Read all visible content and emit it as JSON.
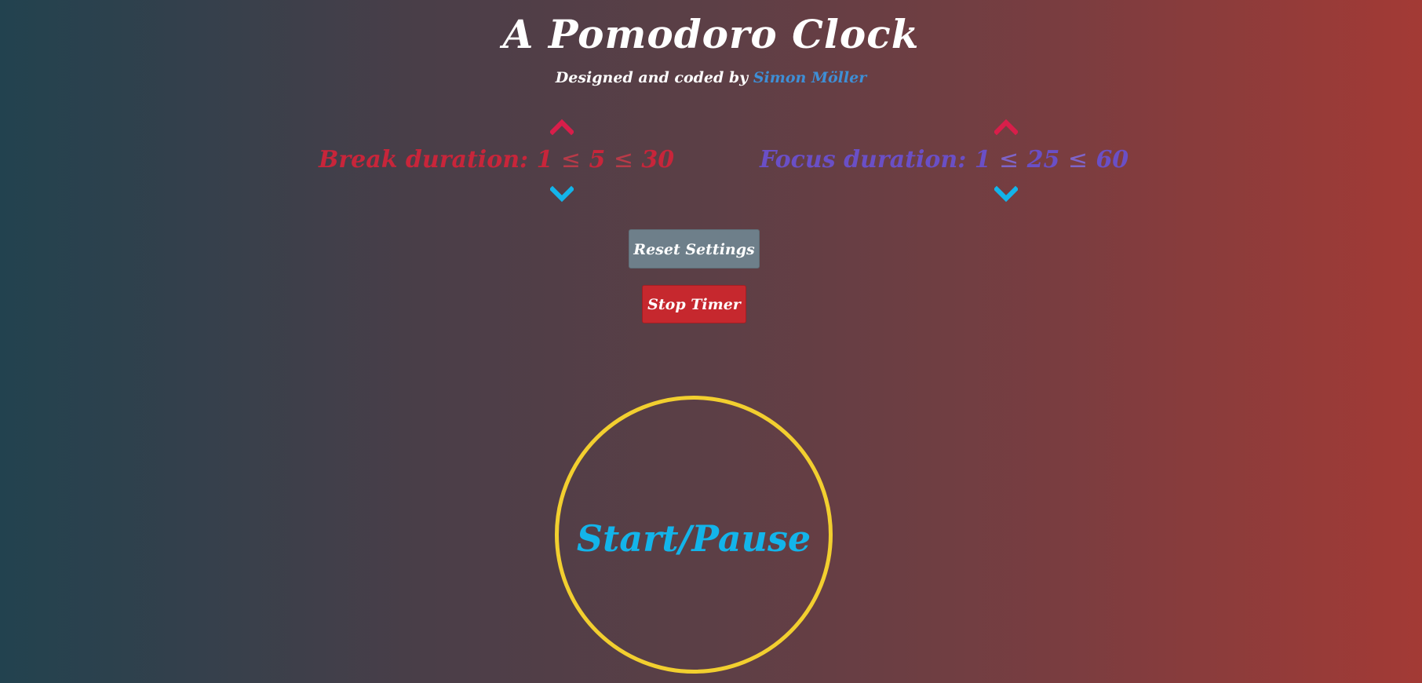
{
  "header": {
    "title": "A Pomodoro Clock",
    "byline_prefix": "Designed and coded by ",
    "author": "Simon Möller"
  },
  "break_setting": {
    "label": "Break duration:",
    "min": "1",
    "value": "5",
    "max": "30",
    "le": "≤"
  },
  "focus_setting": {
    "label": "Focus duration:",
    "min": "1",
    "value": "25",
    "max": "60",
    "le": "≤"
  },
  "buttons": {
    "reset_label": "Reset Settings",
    "stop_label": "Stop Timer"
  },
  "timer": {
    "label": "Start/Pause"
  },
  "colors": {
    "up_arrow": "#d81e4a",
    "down_arrow": "#13b4ea",
    "break_color": "#c8253a",
    "focus_color": "#6a4fc6",
    "circle_border": "#f2cf2f",
    "timer_text": "#13b4ea"
  },
  "icons": {
    "up": "chevron-up-icon",
    "down": "chevron-down-icon"
  }
}
